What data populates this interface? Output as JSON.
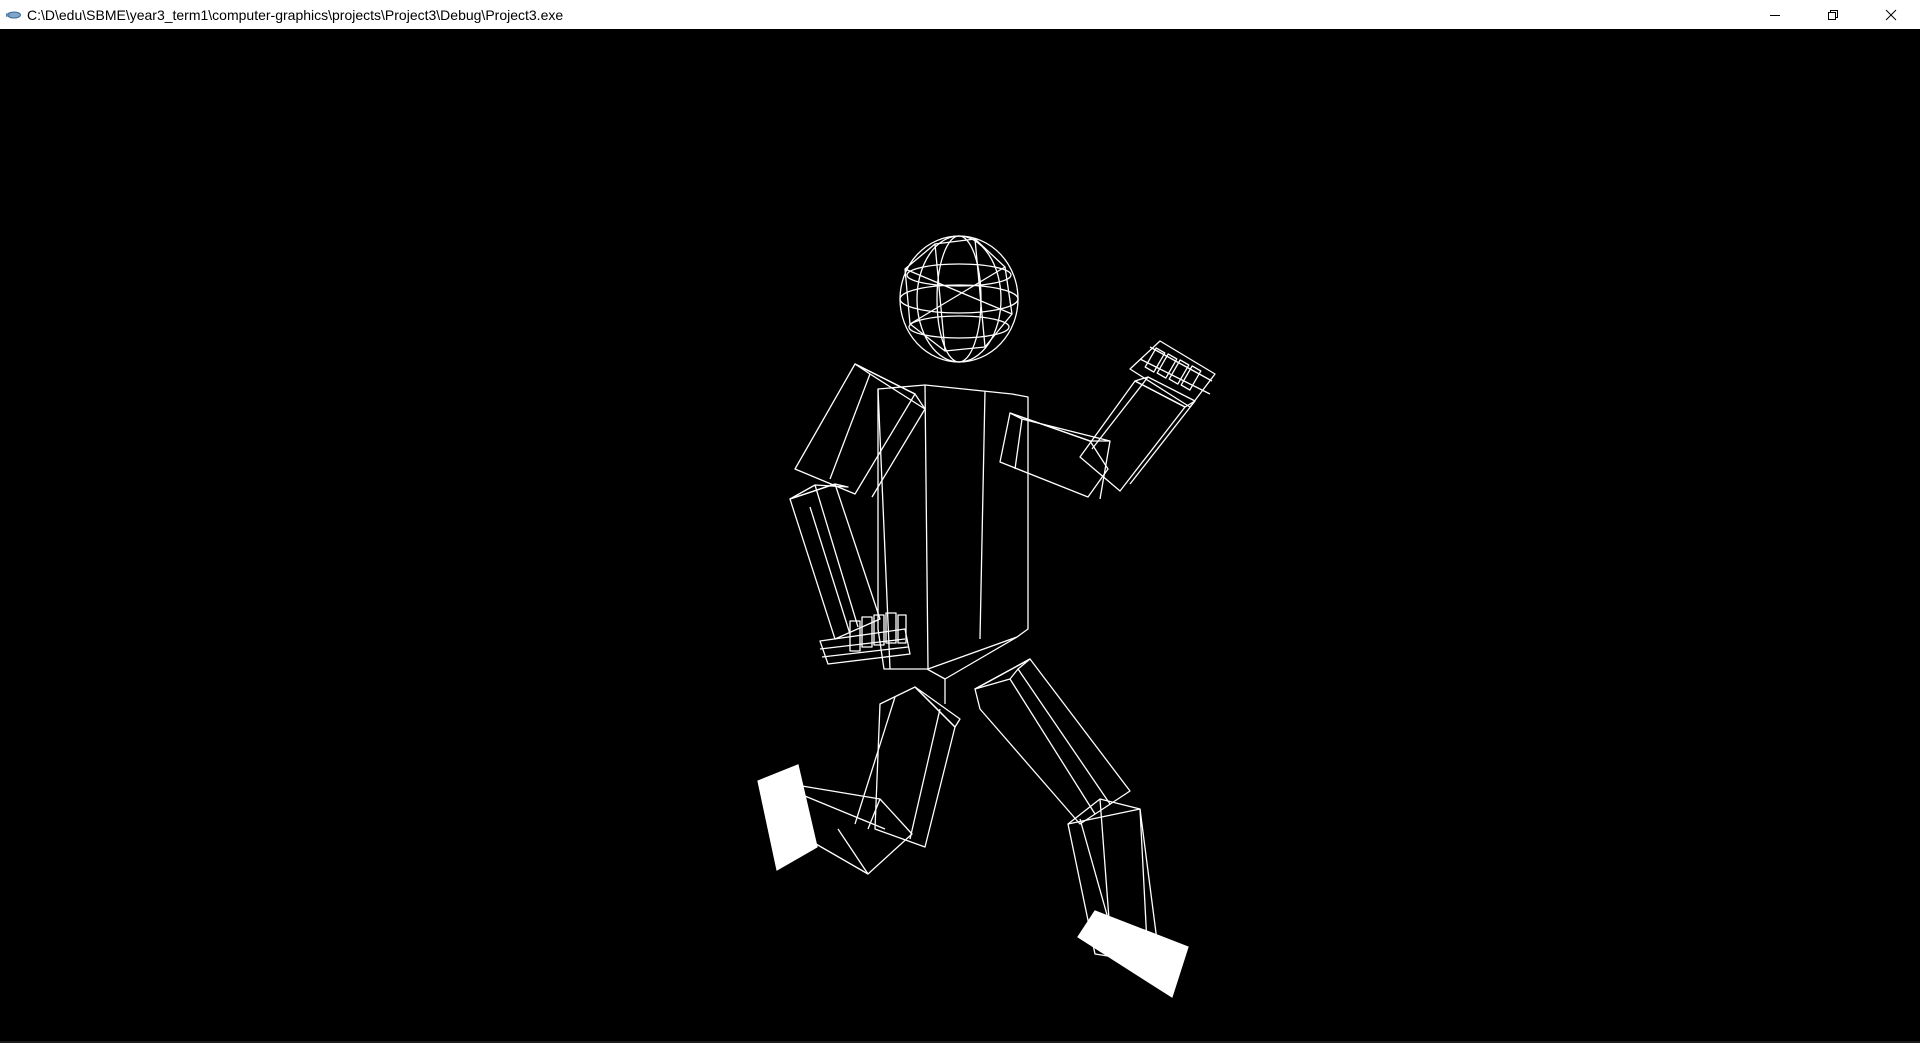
{
  "window": {
    "title": "C:\\D\\edu\\SBME\\year3_term1\\computer-graphics\\projects\\Project3\\Debug\\Project3.exe",
    "controls": {
      "minimize": "minimize",
      "restore": "restore",
      "close": "close"
    }
  },
  "scene": {
    "background": "#000000",
    "line_color": "#ffffff",
    "render_mode": "wireframe",
    "figure": "articulated humanoid (sphere head, box torso, limbs, fingers, solid feet)"
  }
}
